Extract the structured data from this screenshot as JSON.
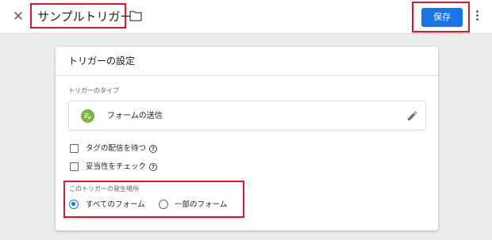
{
  "header": {
    "close_icon": "close-icon",
    "title": "サンプルトリガー",
    "folder_icon": "folder-icon",
    "save_label": "保存",
    "more_icon": "more-vert-icon",
    "accent_color": "#1a73e8",
    "highlight_color": "#e0162b"
  },
  "card": {
    "title": "トリガーの設定",
    "type_section_label": "トリガーのタイプ",
    "trigger_type": {
      "name": "フォームの送信",
      "icon": "form-submit-icon",
      "icon_color": "#7cb342"
    },
    "options": [
      {
        "label": "タグの配信を待つ",
        "checked": false
      },
      {
        "label": "妥当性をチェック",
        "checked": false
      }
    ],
    "fire_section_label": "このトリガーの発生場所",
    "fire_options": [
      {
        "label": "すべてのフォーム",
        "selected": true
      },
      {
        "label": "一部のフォーム",
        "selected": false
      }
    ]
  }
}
